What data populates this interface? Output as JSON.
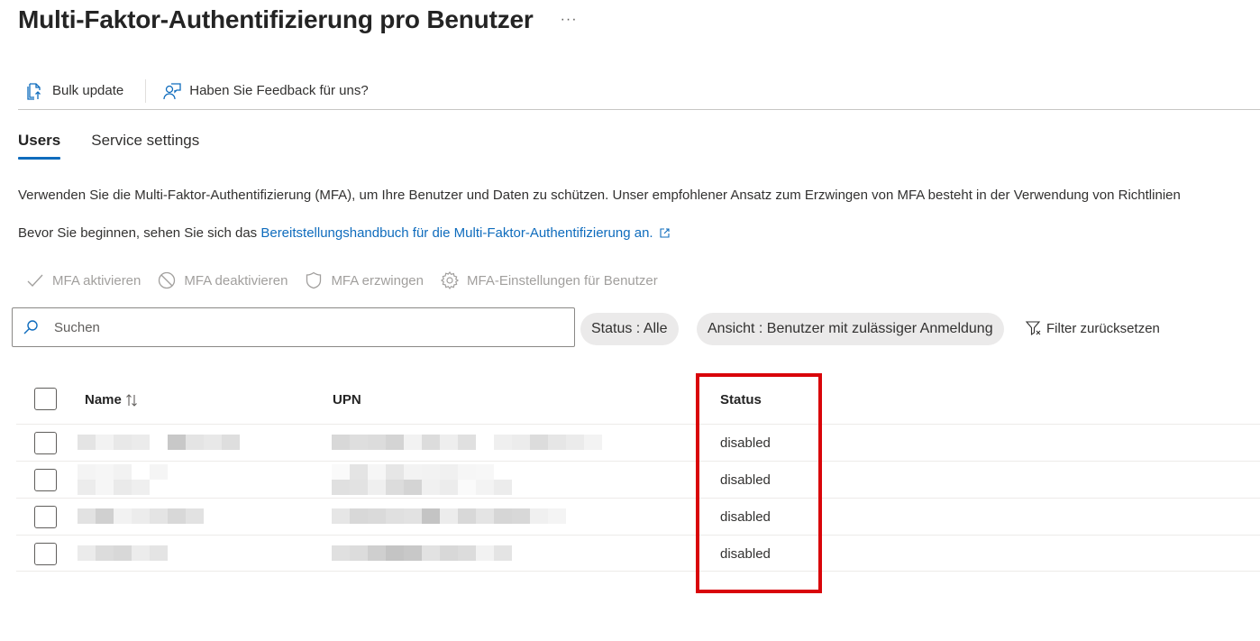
{
  "header": {
    "title": "Multi-Faktor-Authentifizierung pro Benutzer",
    "more_label": "···"
  },
  "commandbar": {
    "bulk_update": "Bulk update",
    "feedback": "Haben Sie Feedback für uns?"
  },
  "tabs": [
    {
      "label": "Users",
      "active": true
    },
    {
      "label": "Service settings",
      "active": false
    }
  ],
  "description": {
    "line1": "Verwenden Sie die Multi-Faktor-Authentifizierung (MFA), um Ihre Benutzer und Daten zu schützen. Unser empfohlener Ansatz zum Erzwingen von MFA besteht in der Verwendung von Richtlinien",
    "line2_prefix": "Bevor Sie beginnen, sehen Sie sich das ",
    "line2_link": "Bereitstellungshandbuch für die Multi-Faktor-Authentifizierung an."
  },
  "actions": [
    {
      "label": "MFA aktivieren",
      "icon": "checkmark-icon",
      "enabled": false
    },
    {
      "label": "MFA deaktivieren",
      "icon": "block-icon",
      "enabled": false
    },
    {
      "label": "MFA erzwingen",
      "icon": "shield-icon",
      "enabled": false
    },
    {
      "label": "MFA-Einstellungen für Benutzer",
      "icon": "gear-icon",
      "enabled": false
    }
  ],
  "filters": {
    "search_placeholder": "Suchen",
    "search_value": "",
    "status_pill": "Status : Alle",
    "view_pill": "Ansicht : Benutzer mit zulässiger Anmeldung",
    "reset_label": "Filter zurücksetzen"
  },
  "table": {
    "columns": {
      "name": "Name",
      "upn": "UPN",
      "status": "Status"
    },
    "rows": [
      {
        "name": "[redacted]",
        "upn": "[redacted]",
        "status": "disabled"
      },
      {
        "name": "[redacted]",
        "upn": "[redacted]",
        "status": "disabled"
      },
      {
        "name": "[redacted]",
        "upn": "[redacted]",
        "status": "disabled"
      },
      {
        "name": "[redacted]",
        "upn": "[redacted]",
        "status": "disabled"
      }
    ]
  },
  "colors": {
    "accent": "#0f6cbd",
    "highlight_box": "#d9050a",
    "disabled_text": "#a19f9d"
  }
}
